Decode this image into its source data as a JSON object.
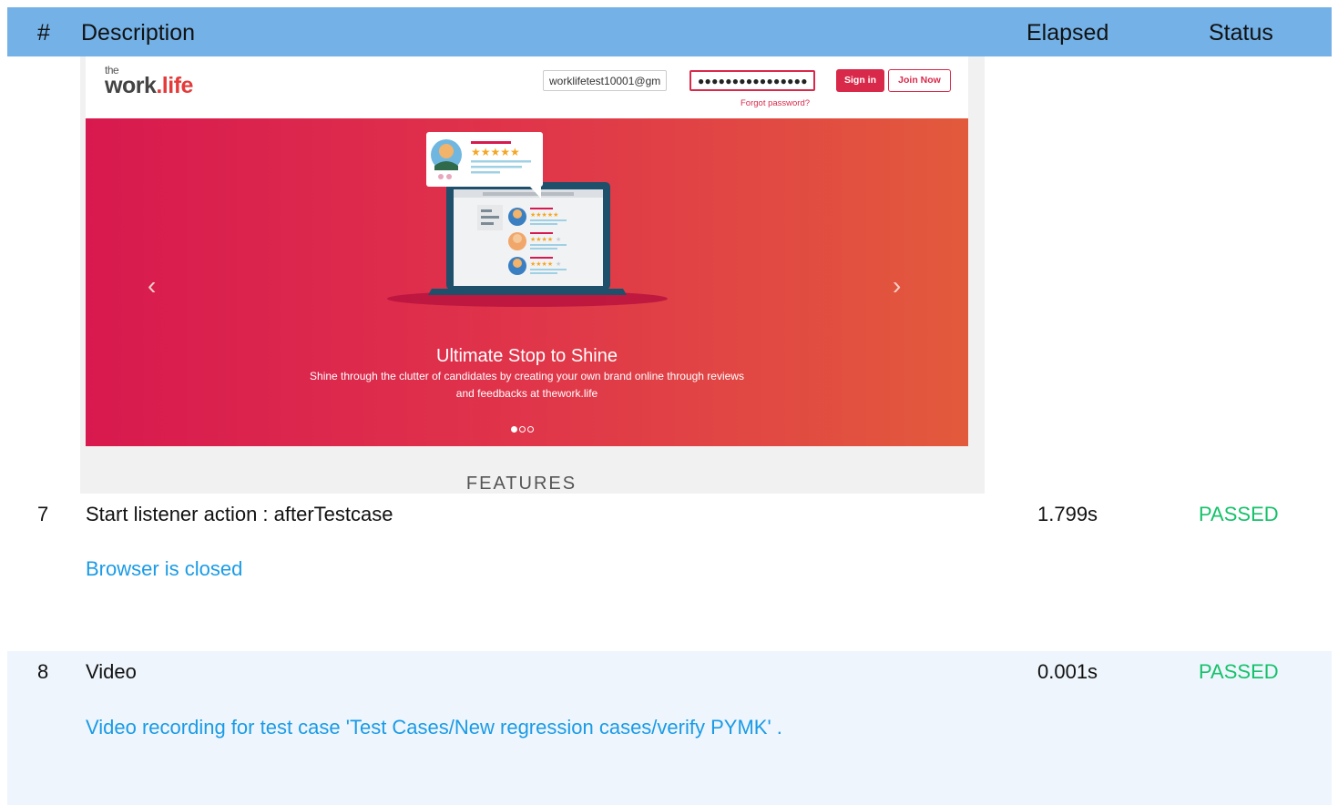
{
  "header": {
    "num": "#",
    "description": "Description",
    "elapsed": "Elapsed",
    "status": "Status"
  },
  "screenshot": {
    "logo_the": "the",
    "logo_work": "work",
    "logo_life": ".life",
    "email_value": "worklifetest10001@gm",
    "password_mask": "●●●●●●●●●●●●●●●●",
    "forgot_label": "Forgot password?",
    "signin_label": "Sign in",
    "joinnow_label": "Join Now",
    "hero_title": "Ultimate Stop to Shine",
    "hero_subtitle_1": "Shine through the clutter of candidates by creating your own brand online through reviews",
    "hero_subtitle_2": "and feedbacks at thework.life",
    "arrow_left": "‹",
    "arrow_right": "›",
    "features_label": "FEATURES",
    "carousel": {
      "slides": 3,
      "active": 1
    },
    "colors": {
      "brand": "#d9294a",
      "hero_start": "#d8194f",
      "hero_end": "#e25a3c"
    },
    "illustration": {
      "review_card_stars": 5,
      "list_item_stars": [
        5,
        4,
        4
      ]
    }
  },
  "rows": [
    {
      "num": "7",
      "description": "Start listener action : afterTestcase",
      "elapsed": "1.799s",
      "status": "PASSED",
      "message": "Browser is closed"
    },
    {
      "num": "8",
      "description": "Video",
      "elapsed": "0.001s",
      "status": "PASSED",
      "message": "Video recording for test case 'Test Cases/New regression cases/verify PYMK' ."
    }
  ],
  "colors": {
    "header_bg": "#73b1e7",
    "link": "#1a9be6",
    "passed": "#16c26b",
    "row_alt_bg": "#eef5fd"
  }
}
